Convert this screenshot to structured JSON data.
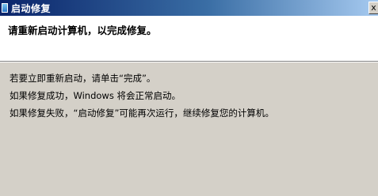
{
  "window": {
    "title": "启动修复",
    "close_glyph": "x"
  },
  "header": {
    "instruction": "请重新启动计算机，以完成修复。"
  },
  "body": {
    "lines": [
      "若要立即重新启动，请单击“完成”。",
      "如果修复成功，Windows 将会正常启动。",
      "如果修复失败，“启动修复”可能再次运行，继续修复您的计算机。"
    ]
  },
  "colors": {
    "title_bar_start": "#0a246a",
    "title_bar_end": "#a6caf0",
    "dialog_background": "#d4d0c8",
    "header_background": "#ffffff"
  },
  "icons": {
    "app": "startup-repair-icon",
    "close": "close-icon"
  }
}
